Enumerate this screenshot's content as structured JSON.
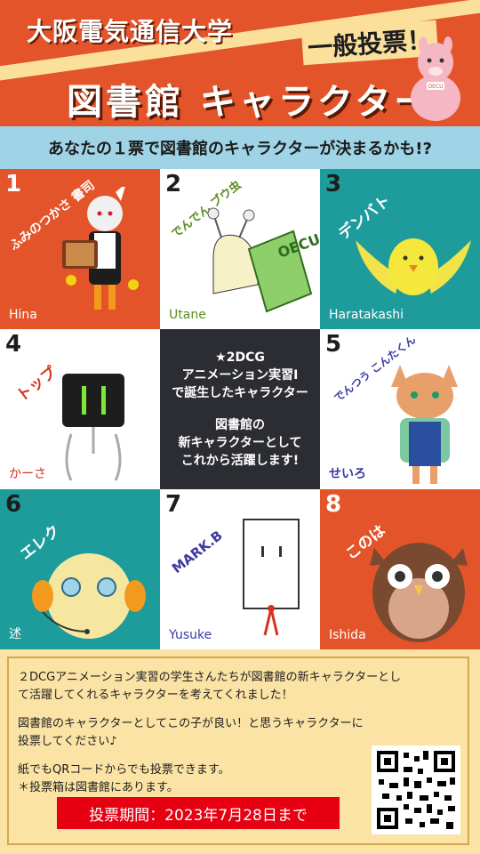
{
  "header": {
    "university": "大阪電気通信大学",
    "vote_badge": "一般投票！",
    "title": "図書館 キャラクター",
    "alpaca_label": "OECU"
  },
  "subtitle": "あなたの１票で図書館のキャラクターが決まるかも!?",
  "characters": [
    {
      "number": "1",
      "name": "ふみのつかさ 書司",
      "creator": "Hina"
    },
    {
      "number": "2",
      "name": "でんでん ブウ虫",
      "creator": "Utane",
      "book_text": "OECU"
    },
    {
      "number": "3",
      "name": "デンバト",
      "creator": "Haratakashi"
    },
    {
      "number": "4",
      "name": "トップ",
      "creator": "かーさ"
    },
    {
      "number": "5",
      "name": "でんつう こんたくん",
      "creator": "せいろ"
    },
    {
      "number": "6",
      "name": "エレク",
      "creator": "述"
    },
    {
      "number": "7",
      "name": "MARK.B",
      "creator": "Yusuke"
    },
    {
      "number": "8",
      "name": "このは",
      "creator": "Ishida"
    }
  ],
  "center_text": {
    "line1": "★2DCG",
    "line2": "アニメーション実習Ⅰ",
    "line3": "で誕生したキャラクター",
    "line4": "図書館の",
    "line5": "新キャラクターとして",
    "line6": "これから活躍します!"
  },
  "footer": {
    "p1_line1": "２DCGアニメーション実習の学生さんたちが図書館の新キャラクターとし",
    "p1_line2": "て活躍してくれるキャラクターを考えてくれました！",
    "p2_line1": "図書館のキャラクターとしてこの子が良い！と思うキャラクターに",
    "p2_line2": "投票してください♪",
    "p3_line1": "紙でもQRコードからでも投票できます。",
    "p3_line2": "＊投票箱は図書館にあります。",
    "period": "投票期間：2023年7月28日まで"
  },
  "colors": {
    "orange": "#e4542a",
    "teal": "#1e9b9b",
    "dark": "#2b2d33",
    "cream": "#fbe3a5",
    "sky": "#9fd3e6",
    "red": "#e60012"
  }
}
